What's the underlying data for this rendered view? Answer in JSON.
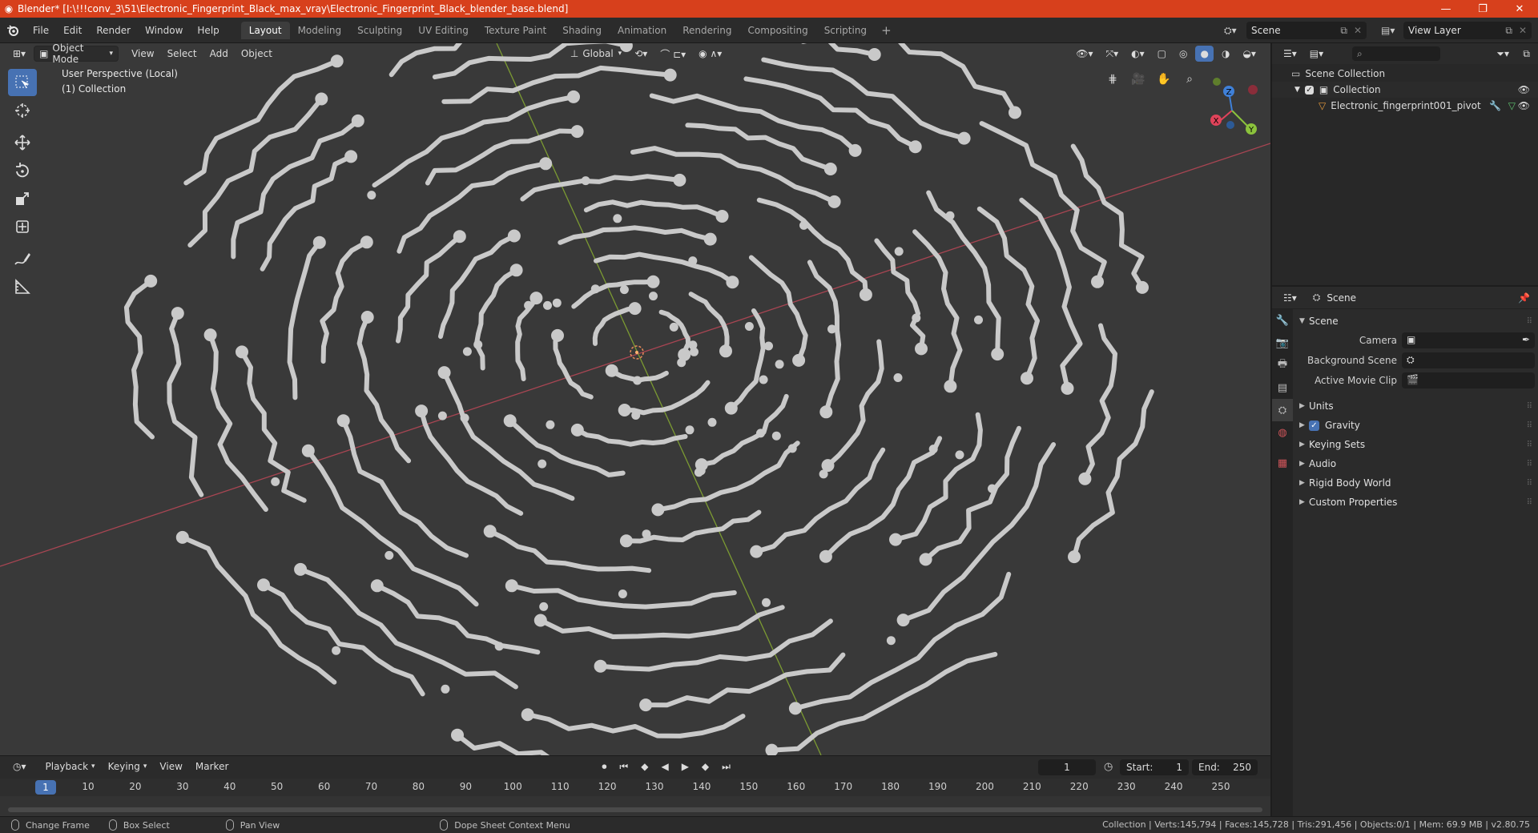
{
  "window": {
    "title": "Blender* [I:\\!!!conv_3\\51\\Electronic_Fingerprint_Black_max_vray\\Electronic_Fingerprint_Black_blender_base.blend]",
    "min": "—",
    "max": "❐",
    "close": "✕"
  },
  "menu": {
    "items": [
      "File",
      "Edit",
      "Render",
      "Window",
      "Help"
    ],
    "workspaces": [
      "Layout",
      "Modeling",
      "Sculpting",
      "UV Editing",
      "Texture Paint",
      "Shading",
      "Animation",
      "Rendering",
      "Compositing",
      "Scripting"
    ],
    "active_workspace": "Layout",
    "add": "+",
    "scene": "Scene",
    "view_layer": "View Layer"
  },
  "viewport": {
    "mode": "Object Mode",
    "menus": [
      "View",
      "Select",
      "Add",
      "Object"
    ],
    "transform_orientation": "Global",
    "perspective_label": "User Perspective (Local)",
    "collection_label": "(1) Collection",
    "gizmo": {
      "x": "X",
      "y": "Y",
      "z": "Z"
    },
    "colors": {
      "x_axis": "#e0435a",
      "y_axis": "#8bc23c",
      "z_axis": "#3f80d8",
      "bg": "#393939",
      "trace": "#c9c9c9"
    }
  },
  "timeline": {
    "menus": [
      "Playback",
      "Keying",
      "View",
      "Marker"
    ],
    "current_frame": "1",
    "start_label": "Start:",
    "start": "1",
    "end_label": "End:",
    "end": "250",
    "ruler": [
      "1",
      "10",
      "20",
      "30",
      "40",
      "50",
      "60",
      "70",
      "80",
      "90",
      "100",
      "110",
      "120",
      "130",
      "140",
      "150",
      "160",
      "170",
      "180",
      "190",
      "200",
      "210",
      "220",
      "230",
      "240",
      "250"
    ]
  },
  "statusbar": {
    "items": [
      "Change Frame",
      "Box Select",
      "Pan View",
      "Dope Sheet Context Menu"
    ],
    "stats": "Collection | Verts:145,794 | Faces:145,728 | Tris:291,456 | Objects:0/1 | Mem: 69.9 MB | v2.80.75"
  },
  "outliner": {
    "scene_collection": "Scene Collection",
    "collection": "Collection",
    "object": "Electronic_fingerprint001_pivot"
  },
  "properties": {
    "header": "Scene",
    "panel": "Scene",
    "fields": {
      "camera": "Camera",
      "background_scene": "Background Scene",
      "active_movie_clip": "Active Movie Clip"
    },
    "subpanels": [
      "Units",
      "Gravity",
      "Keying Sets",
      "Audio",
      "Rigid Body World",
      "Custom Properties"
    ]
  }
}
